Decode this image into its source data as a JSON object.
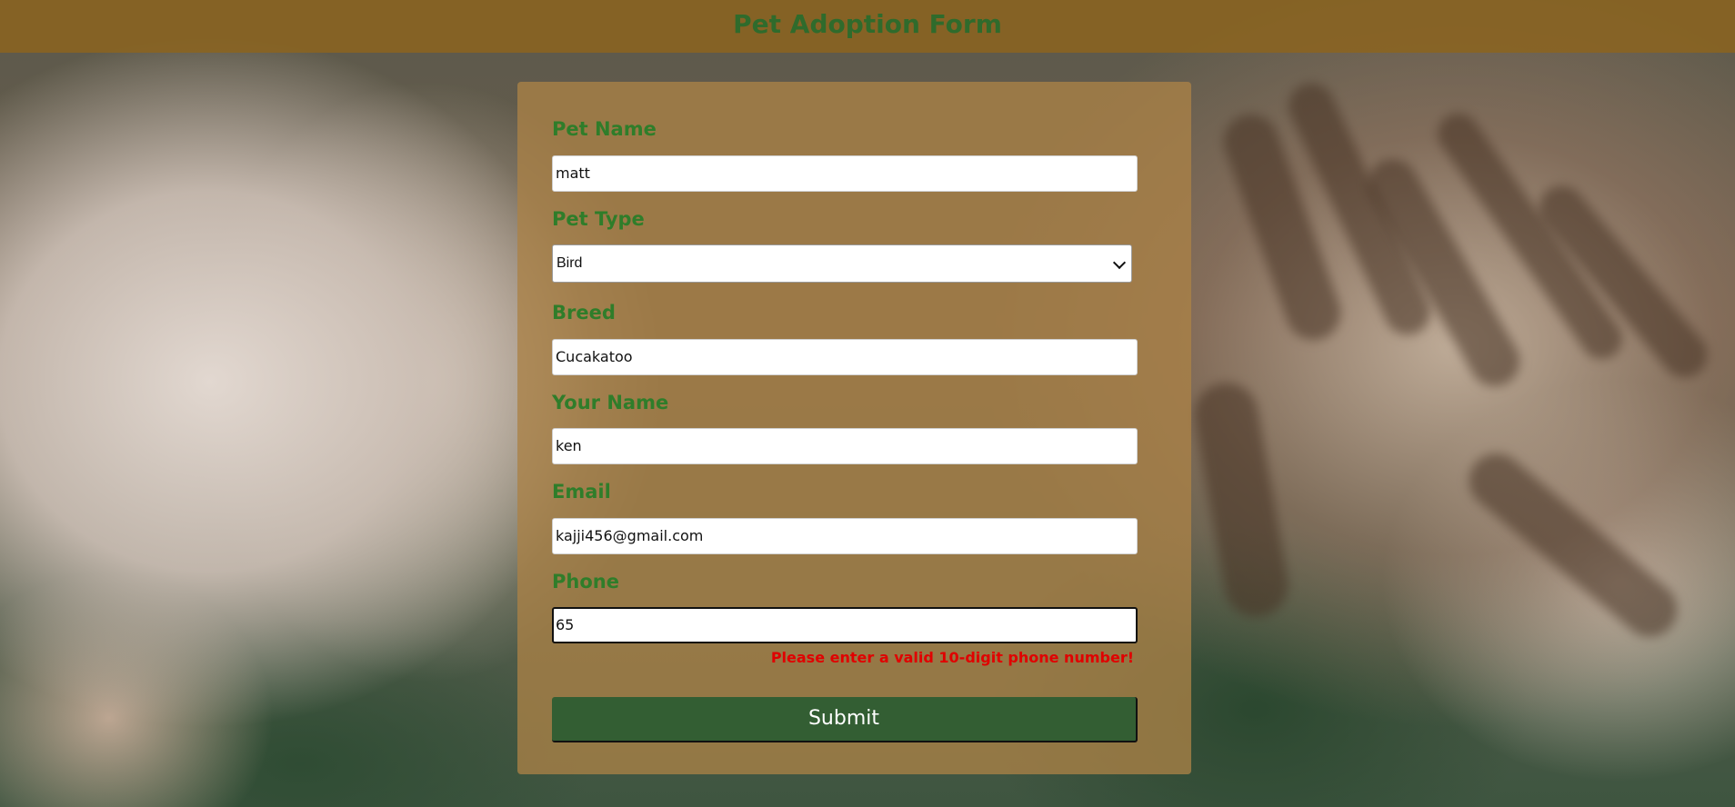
{
  "header": {
    "title": "Pet Adoption Form"
  },
  "form": {
    "pet_name": {
      "label": "Pet Name",
      "value": "matt"
    },
    "pet_type": {
      "label": "Pet Type",
      "selected": "Bird"
    },
    "breed": {
      "label": "Breed",
      "value": "Cucakatoo"
    },
    "your_name": {
      "label": "Your Name",
      "value": "ken"
    },
    "email": {
      "label": "Email",
      "value": "kajji456@gmail.com"
    },
    "phone": {
      "label": "Phone",
      "value": "65",
      "error": "Please enter a valid 10-digit phone number!"
    },
    "submit_label": "Submit"
  },
  "colors": {
    "header_bg": "#8c641e",
    "label_green": "#2f7d2a",
    "button_green": "#335e33",
    "error_red": "#e00000"
  },
  "icons": {
    "select_arrow": "chevron-down-icon"
  }
}
